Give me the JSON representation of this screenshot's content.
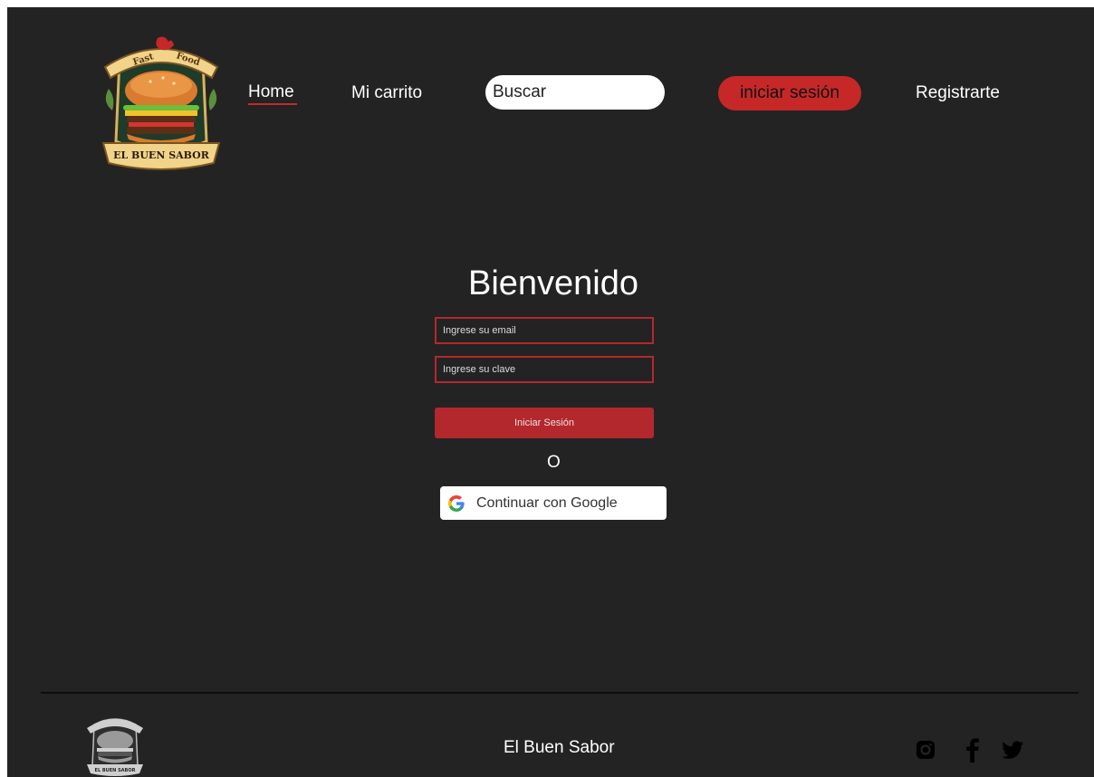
{
  "header": {
    "logo": {
      "top_text": "Fast Food",
      "banner_text": "EL BUEN SABOR"
    },
    "nav": {
      "home": "Home",
      "cart": "Mi carrito",
      "login": "iniciar sesión",
      "register": "Registrarte"
    },
    "search": {
      "placeholder": "Buscar"
    }
  },
  "main": {
    "title": "Bienvenido",
    "email_placeholder": "Ingrese su email",
    "password_placeholder": "Ingrese su clave",
    "submit_label": "Iniciar Sesión",
    "or_text": "O",
    "google_label": "Continuar con Google"
  },
  "footer": {
    "logo_text": "EL BUEN SABOR",
    "title": "El Buen Sabor"
  },
  "colors": {
    "background": "#232323",
    "accent": "#c62828",
    "input_border": "#b3282d",
    "footer_line": "#0d0d0d"
  },
  "icons": {
    "search": "search-icon",
    "google": "google-icon",
    "instagram": "instagram-icon",
    "facebook": "facebook-icon",
    "twitter": "twitter-icon"
  }
}
